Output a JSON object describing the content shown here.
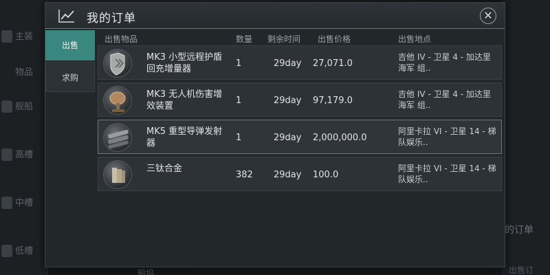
{
  "background": {
    "left_items": [
      "主装",
      "物品",
      "舰船",
      "高槽",
      "中槽",
      "低槽"
    ],
    "right_text": "的订单",
    "right_text_2": "出售订",
    "bottom_text": "船坞"
  },
  "modal": {
    "title": "我的订单",
    "close_label": "✕",
    "tabs": [
      {
        "label": "出售",
        "active": true
      },
      {
        "label": "求购",
        "active": false
      }
    ],
    "columns": [
      "出售物品",
      "数量",
      "剩余时间",
      "出售价格",
      "出售地点"
    ],
    "rows": [
      {
        "name": "MK3 小型远程护盾回充增量器",
        "quantity": "1",
        "time_left": "29day",
        "price": "27,071.0",
        "location": "吉他 IV - 卫星 4 - 加达里海军 组..",
        "icon": "shield-booster-icon",
        "selected": false
      },
      {
        "name": "MK3 无人机伤害增效装置",
        "quantity": "1",
        "time_left": "29day",
        "price": "97,179.0",
        "location": "吉他 IV - 卫星 4 - 加达里海军 组..",
        "icon": "drone-damage-icon",
        "selected": false
      },
      {
        "name": "MK5 重型导弹发射器",
        "quantity": "1",
        "time_left": "29day",
        "price": "2,000,000.0",
        "location": "阿里卡拉 VI - 卫星 14 - 梯队娱乐..",
        "icon": "missile-launcher-icon",
        "selected": true
      },
      {
        "name": "三钛合金",
        "quantity": "382",
        "time_left": "29day",
        "price": "100.0",
        "location": "阿里卡拉 VI - 卫星 14 - 梯队娱乐..",
        "icon": "tritanium-icon",
        "selected": false
      }
    ]
  },
  "colors": {
    "accent": "#3a8780",
    "header_line": "#3b8c86"
  }
}
